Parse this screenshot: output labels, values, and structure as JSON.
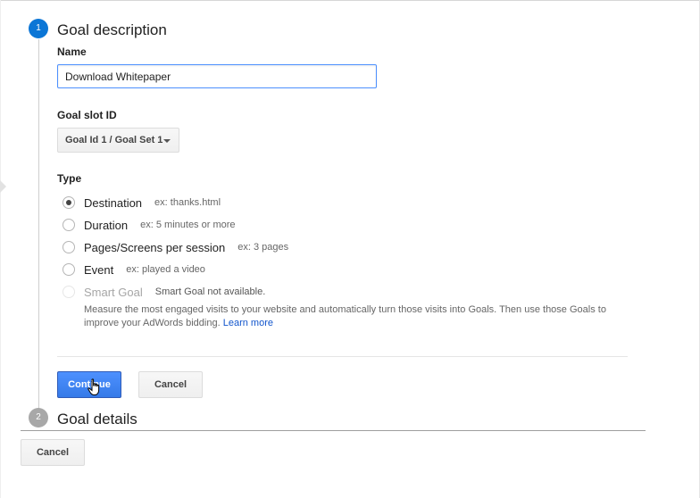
{
  "steps": [
    {
      "number": "1",
      "title": "Goal description",
      "color": "#0b76d6"
    },
    {
      "number": "2",
      "title": "Goal details",
      "color": "#a8a8a8"
    }
  ],
  "name_field": {
    "label": "Name",
    "value": "Download Whitepaper"
  },
  "goal_slot": {
    "label": "Goal slot ID",
    "selected": "Goal Id 1 / Goal Set 1"
  },
  "type": {
    "label": "Type",
    "options": [
      {
        "label": "Destination",
        "example": "ex: thanks.html",
        "checked": true,
        "disabled": false
      },
      {
        "label": "Duration",
        "example": "ex: 5 minutes or more",
        "checked": false,
        "disabled": false
      },
      {
        "label": "Pages/Screens per session",
        "example": "ex: 3 pages",
        "checked": false,
        "disabled": false
      },
      {
        "label": "Event",
        "example": "ex: played a video",
        "checked": false,
        "disabled": false
      },
      {
        "label": "Smart Goal",
        "example": "Smart Goal not available.",
        "checked": false,
        "disabled": true
      }
    ],
    "smart_goal_description": "Measure the most engaged visits to your website and automatically turn those visits into Goals. Then use those Goals to improve your AdWords bidding.",
    "learn_more": "Learn more"
  },
  "buttons": {
    "continue": "Continue",
    "cancel_step": "Cancel",
    "cancel_main": "Cancel"
  },
  "colors": {
    "accent": "#4d90fe",
    "link": "#1155cc",
    "step_active": "#0b76d6"
  },
  "icons": {
    "cursor": "hand-pointer-icon",
    "dropdown": "caret-down-icon"
  }
}
